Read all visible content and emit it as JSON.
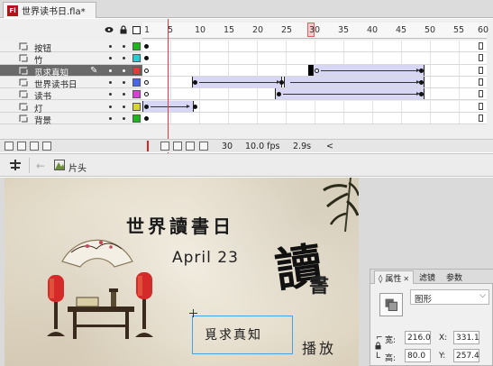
{
  "document": {
    "tab_title": "世界读书日.fla*",
    "app_badge": "Fl"
  },
  "timeline": {
    "header_icons": [
      "eye-icon",
      "lock-icon",
      "outline-icon"
    ],
    "ruler_numbers": [
      "1",
      "5",
      "10",
      "15",
      "20",
      "25",
      "30",
      "35",
      "40",
      "45",
      "50",
      "55",
      "60"
    ],
    "current_frame": 30,
    "layers": [
      {
        "name": "按钮",
        "color": "#1fb51f",
        "selected": false
      },
      {
        "name": "竹",
        "color": "#2ec8d6",
        "selected": false
      },
      {
        "name": "觅求真知",
        "color": "#e23c3c",
        "selected": true
      },
      {
        "name": "世界读书日",
        "color": "#4a66e8",
        "selected": false
      },
      {
        "name": "读书",
        "color": "#d640d6",
        "selected": false
      },
      {
        "name": "灯",
        "color": "#d8d81e",
        "selected": false
      },
      {
        "name": "背景",
        "color": "#1fb51f",
        "selected": false
      }
    ],
    "status": {
      "frame": "30",
      "fps": "10.0 fps",
      "time": "2.9s",
      "scroll_left": "<"
    }
  },
  "editbar": {
    "back_arrow": "←",
    "scene_label": "片头"
  },
  "stage": {
    "title": "世界讀書日",
    "date": "April 23",
    "calligraphy_big": "讀",
    "calligraphy_small": "書",
    "selected_text": "覓求真知",
    "bottom_text": "播放"
  },
  "properties": {
    "tabs": [
      "属性",
      "滤镜",
      "参数"
    ],
    "type_value": "图形",
    "width_label": "宽:",
    "width_value": "216.0",
    "x_label": "X:",
    "x_value": "331.1",
    "height_label": "高:",
    "height_value": "80.0",
    "y_label": "Y:",
    "y_value": "257.4"
  }
}
